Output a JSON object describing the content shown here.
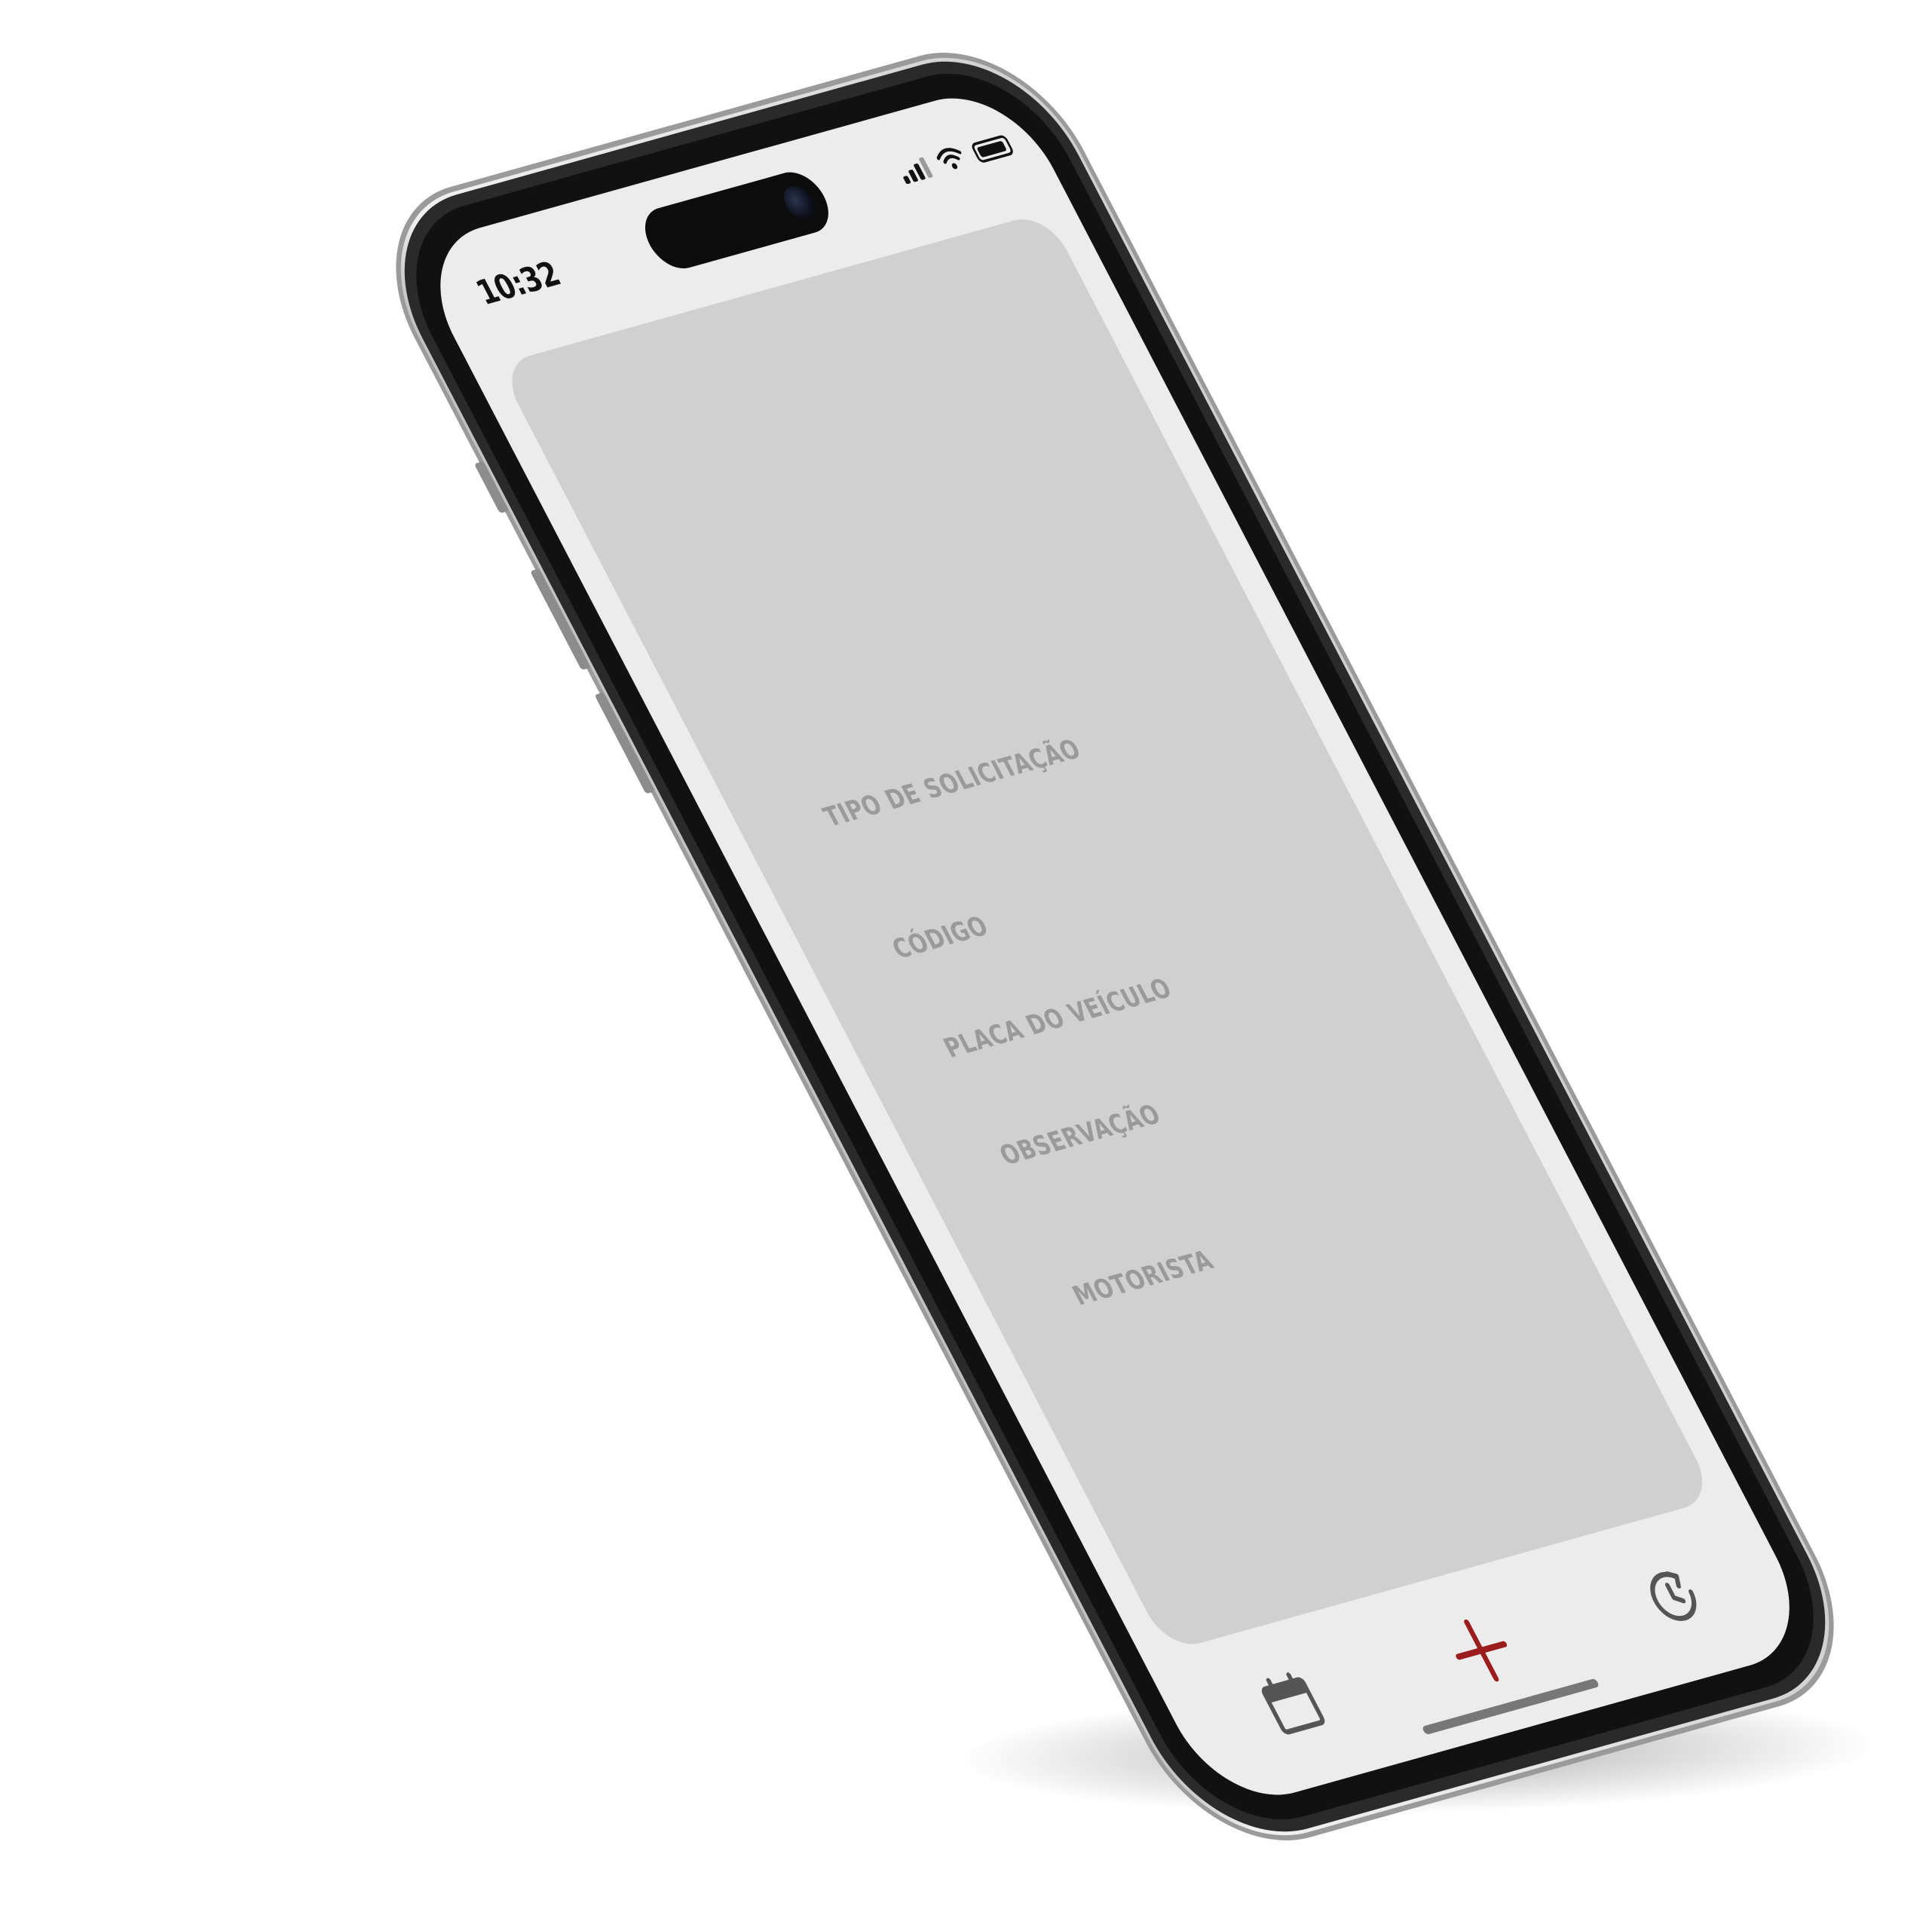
{
  "status_bar": {
    "time": "10:32",
    "icons": [
      "signal-icon",
      "wifi-icon",
      "battery-icon"
    ]
  },
  "form": {
    "fields": [
      {
        "label": "TIPO DE SOLICITAÇÃO"
      },
      {
        "label": "CÓDIGO"
      },
      {
        "label": "PLACA DO VEÍCULO"
      },
      {
        "label": "OBSERVAÇÃO"
      },
      {
        "label": "MOTORISTA"
      }
    ]
  },
  "tab_bar": {
    "tabs": [
      {
        "icon": "calendar-icon",
        "color": "#555555"
      },
      {
        "icon": "plus-icon",
        "color": "#9b1c1c",
        "active": true
      },
      {
        "icon": "history-clock-icon",
        "color": "#555555"
      }
    ]
  },
  "colors": {
    "screen_background": "#ececec",
    "card_background": "#d0d0d0",
    "label_text": "#9a9a9a",
    "accent": "#9b1c1c",
    "phone_body": "#e6e6e6",
    "bezel": "#111111"
  }
}
